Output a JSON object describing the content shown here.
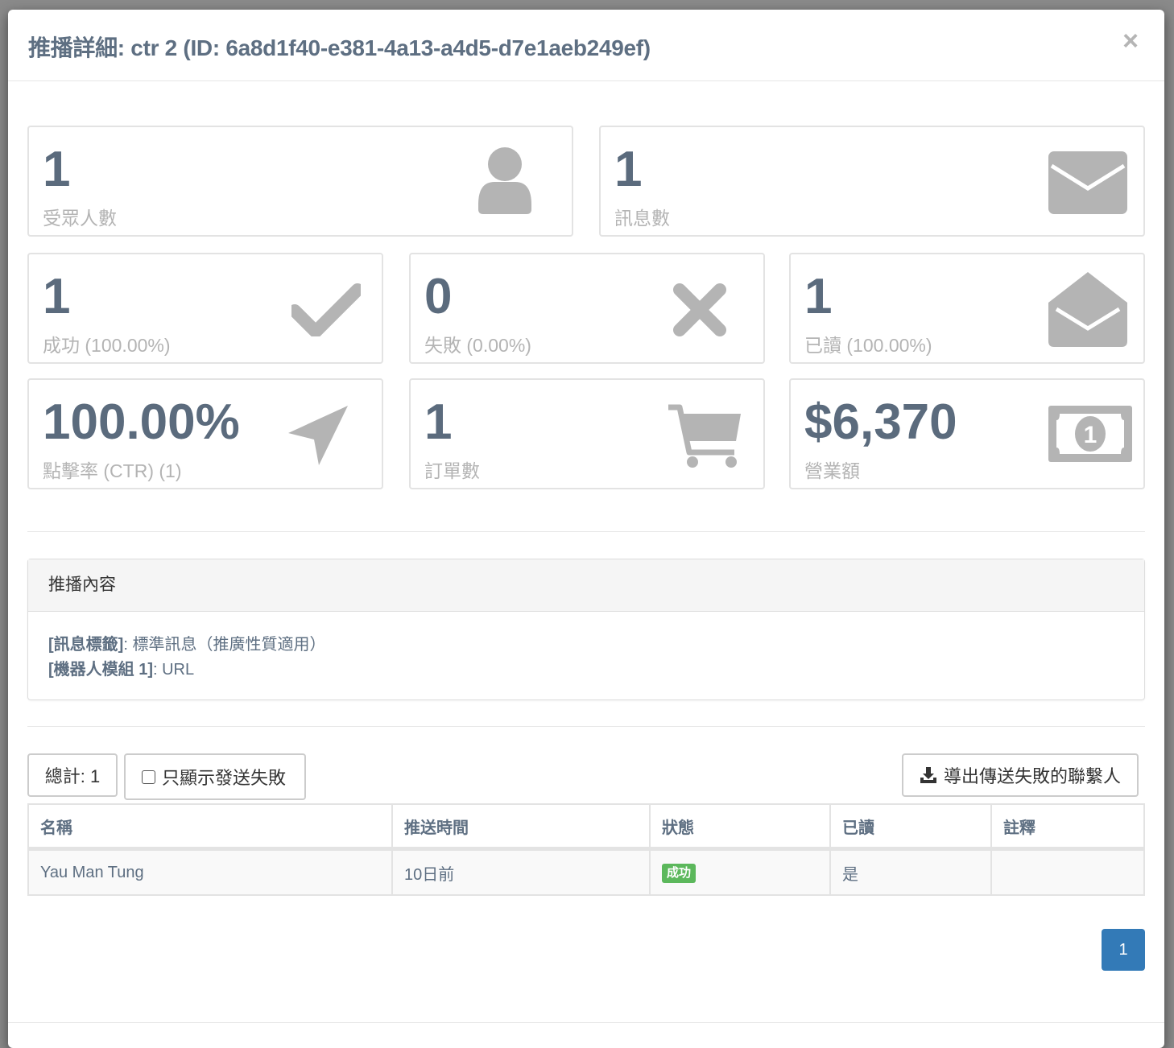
{
  "modal": {
    "title": "推播詳細: ctr 2 (ID: 6a8d1f40-e381-4a13-a4d5-d7e1aeb249ef)",
    "close_label": "×"
  },
  "stats": {
    "audience": {
      "value": "1",
      "label": "受眾人數",
      "icon": "user-icon"
    },
    "messages": {
      "value": "1",
      "label": "訊息數",
      "icon": "envelope-icon"
    },
    "success": {
      "value": "1",
      "label": "成功 (100.00%)",
      "icon": "check-icon"
    },
    "failed": {
      "value": "0",
      "label": "失敗 (0.00%)",
      "icon": "times-icon"
    },
    "read": {
      "value": "1",
      "label": "已讀 (100.00%)",
      "icon": "envelope-open-icon"
    },
    "ctr": {
      "value": "100.00%",
      "label": "點擊率 (CTR) (1)",
      "icon": "location-arrow-icon"
    },
    "orders": {
      "value": "1",
      "label": "訂單數",
      "icon": "shopping-cart-icon"
    },
    "revenue": {
      "value": "$6,370",
      "label": "營業額",
      "icon": "money-icon"
    }
  },
  "content_panel": {
    "heading": "推播內容",
    "lines": [
      {
        "key": "[訊息標籤]",
        "value": ": 標準訊息（推廣性質適用）"
      },
      {
        "key": "[機器人模組 1]",
        "value": ": URL"
      }
    ]
  },
  "toolbar": {
    "total_label": "總計: 1",
    "failed_only_label": "只顯示發送失敗",
    "export_label": "導出傳送失敗的聯繫人"
  },
  "table": {
    "headers": [
      "名稱",
      "推送時間",
      "狀態",
      "已讀",
      "註釋"
    ],
    "rows": [
      {
        "name": "Yau Man Tung",
        "time": "10日前",
        "status": "成功",
        "read": "是",
        "note": ""
      }
    ]
  },
  "pagination": {
    "current": "1"
  },
  "colors": {
    "accent": "#337ab7",
    "success": "#5cb85c",
    "text": "#5e6f82",
    "icon_gray": "#b4b4b4"
  }
}
